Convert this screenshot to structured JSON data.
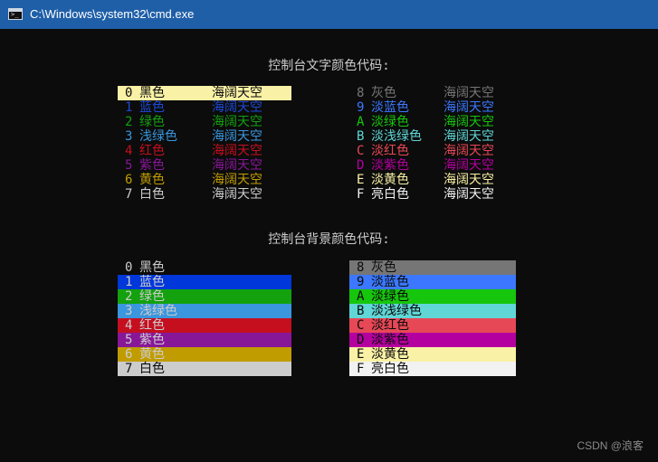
{
  "window": {
    "title": "C:\\Windows\\system32\\cmd.exe"
  },
  "text_section": {
    "heading": "控制台文字颜色代码:",
    "left": [
      {
        "code": "0",
        "name": "黑色",
        "sample": "海阔天空",
        "color": "#0c0c0c",
        "bg": "#f9f1a5",
        "highlighted": true
      },
      {
        "code": "1",
        "name": "蓝色",
        "sample": "海阔天空",
        "color": "#1c49d6",
        "bg": "",
        "highlighted": false
      },
      {
        "code": "2",
        "name": "绿色",
        "sample": "海阔天空",
        "color": "#13a10e",
        "bg": "",
        "highlighted": false
      },
      {
        "code": "3",
        "name": "浅绿色",
        "sample": "海阔天空",
        "color": "#3a96dd",
        "bg": "",
        "highlighted": false
      },
      {
        "code": "4",
        "name": "红色",
        "sample": "海阔天空",
        "color": "#c50f1f",
        "bg": "",
        "highlighted": false
      },
      {
        "code": "5",
        "name": "紫色",
        "sample": "海阔天空",
        "color": "#881798",
        "bg": "",
        "highlighted": false
      },
      {
        "code": "6",
        "name": "黄色",
        "sample": "海阔天空",
        "color": "#c19c00",
        "bg": "",
        "highlighted": false
      },
      {
        "code": "7",
        "name": "白色",
        "sample": "海阔天空",
        "color": "#cccccc",
        "bg": "",
        "highlighted": false
      }
    ],
    "right": [
      {
        "code": "8",
        "name": "灰色",
        "sample": "海阔天空",
        "color": "#767676"
      },
      {
        "code": "9",
        "name": "淡蓝色",
        "sample": "海阔天空",
        "color": "#3b78ff"
      },
      {
        "code": "A",
        "name": "淡绿色",
        "sample": "海阔天空",
        "color": "#16c60c"
      },
      {
        "code": "B",
        "name": "淡浅绿色",
        "sample": "海阔天空",
        "color": "#61d6d6"
      },
      {
        "code": "C",
        "name": "淡红色",
        "sample": "海阔天空",
        "color": "#e74856"
      },
      {
        "code": "D",
        "name": "淡紫色",
        "sample": "海阔天空",
        "color": "#b4009e"
      },
      {
        "code": "E",
        "name": "淡黄色",
        "sample": "海阔天空",
        "color": "#f9f1a5"
      },
      {
        "code": "F",
        "name": "亮白色",
        "sample": "海阔天空",
        "color": "#f2f2f2"
      }
    ]
  },
  "background_section": {
    "heading": "控制台背景颜色代码:",
    "left": [
      {
        "code": "0",
        "name": "黑色",
        "bg": "#0c0c0c",
        "color": "#cccccc"
      },
      {
        "code": "1",
        "name": "蓝色",
        "bg": "#0037da",
        "color": "#cccccc"
      },
      {
        "code": "2",
        "name": "绿色",
        "bg": "#13a10e",
        "color": "#cccccc"
      },
      {
        "code": "3",
        "name": "浅绿色",
        "bg": "#3a96dd",
        "color": "#cccccc"
      },
      {
        "code": "4",
        "name": "红色",
        "bg": "#c50f1f",
        "color": "#cccccc"
      },
      {
        "code": "5",
        "name": "紫色",
        "bg": "#881798",
        "color": "#cccccc"
      },
      {
        "code": "6",
        "name": "黄色",
        "bg": "#c19c00",
        "color": "#cccccc"
      },
      {
        "code": "7",
        "name": "白色",
        "bg": "#cccccc",
        "color": "#0c0c0c"
      }
    ],
    "right": [
      {
        "code": "8",
        "name": "灰色",
        "bg": "#767676",
        "color": "#0c0c0c"
      },
      {
        "code": "9",
        "name": "淡蓝色",
        "bg": "#3b78ff",
        "color": "#0c0c0c"
      },
      {
        "code": "A",
        "name": "淡绿色",
        "bg": "#16c60c",
        "color": "#0c0c0c"
      },
      {
        "code": "B",
        "name": "淡浅绿色",
        "bg": "#61d6d6",
        "color": "#0c0c0c"
      },
      {
        "code": "C",
        "name": "淡红色",
        "bg": "#e74856",
        "color": "#0c0c0c"
      },
      {
        "code": "D",
        "name": "淡紫色",
        "bg": "#b4009e",
        "color": "#0c0c0c"
      },
      {
        "code": "E",
        "name": "淡黄色",
        "bg": "#f9f1a5",
        "color": "#0c0c0c"
      },
      {
        "code": "F",
        "name": "亮白色",
        "bg": "#f2f2f2",
        "color": "#0c0c0c"
      }
    ]
  },
  "watermark": "CSDN @浪客"
}
